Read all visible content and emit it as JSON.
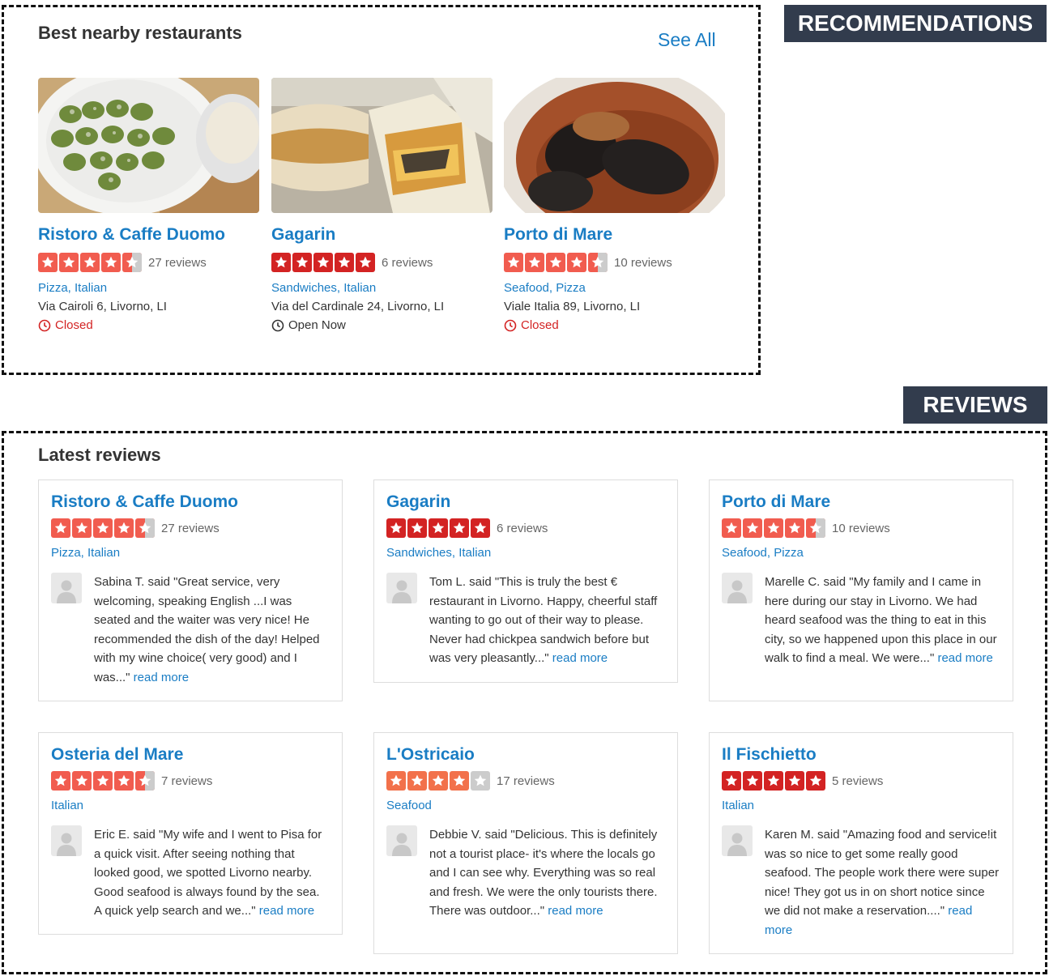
{
  "labels": {
    "recommendations": "RECOMMENDATIONS",
    "reviews": "REVIEWS"
  },
  "recommendations": {
    "title": "Best nearby restaurants",
    "see_all": "See All",
    "items": [
      {
        "name": "Ristoro & Caffe Duomo",
        "rating": 4.5,
        "reviews": "27 reviews",
        "categories": "Pizza, Italian",
        "address": "Via Cairoli 6, Livorno, LI",
        "status": "Closed",
        "open": false
      },
      {
        "name": "Gagarin",
        "rating": 5,
        "reviews": "6 reviews",
        "categories": "Sandwiches, Italian",
        "address": "Via del Cardinale 24, Livorno, LI",
        "status": "Open Now",
        "open": true
      },
      {
        "name": "Porto di Mare",
        "rating": 4.5,
        "reviews": "10 reviews",
        "categories": "Seafood, Pizza",
        "address": "Viale Italia 89, Livorno, LI",
        "status": "Closed",
        "open": false
      }
    ]
  },
  "reviews": {
    "title": "Latest reviews",
    "items": [
      {
        "name": "Ristoro & Caffe Duomo",
        "rating": 4.5,
        "reviews": "27 reviews",
        "categories": "Pizza, Italian",
        "text": "Sabina T. said \"Great service, very welcoming, speaking English ...I was seated and the waiter was very nice! He recommended the dish of the day! Helped with my wine choice( very good) and I was...\" ",
        "read_more": "read more"
      },
      {
        "name": "Gagarin",
        "rating": 5,
        "reviews": "6 reviews",
        "categories": "Sandwiches, Italian",
        "text": "Tom L. said \"This is truly the best € restaurant in Livorno. Happy, cheerful staff wanting to go out of their way to please. Never had chickpea sandwich before but was very pleasantly...\" ",
        "read_more": "read more"
      },
      {
        "name": "Porto di Mare",
        "rating": 4.5,
        "reviews": "10 reviews",
        "categories": "Seafood, Pizza",
        "text": "Marelle C. said \"My family and I came in here during our stay in Livorno. We had heard seafood was the thing to eat in this city, so we happened upon this place in our walk to find a meal. We were...\" ",
        "read_more": "read more"
      },
      {
        "name": "Osteria del Mare",
        "rating": 4.5,
        "reviews": "7 reviews",
        "categories": "Italian",
        "text": "Eric E. said \"My wife and I went to Pisa for a quick visit. After seeing nothing that looked good, we spotted Livorno nearby. Good seafood is always found by the sea. A quick yelp search and we...\" ",
        "read_more": "read more"
      },
      {
        "name": "L'Ostricaio",
        "rating": 4,
        "reviews": "17 reviews",
        "categories": "Seafood",
        "text": "Debbie V. said \"Delicious. This is definitely not a tourist place- it's where the locals go and I can see why. Everything was so real and fresh. We were the only tourists there. There was outdoor...\" ",
        "read_more": "read more"
      },
      {
        "name": "Il Fischietto",
        "rating": 5,
        "reviews": "5 reviews",
        "categories": "Italian",
        "text": "Karen M. said \"Amazing food and service!it was so nice to get some really good seafood. The people work there were super nice! They got us in on short notice since we did not make a reservation....\" ",
        "read_more": "read more"
      }
    ]
  },
  "colors": {
    "link": "#1a7dc4",
    "star_5": "#d32323",
    "star_45": "#f15c4f",
    "star_4": "#f2714b",
    "star_empty": "#cccccc",
    "closed": "#d32323",
    "tag_bg": "#323c4d"
  }
}
